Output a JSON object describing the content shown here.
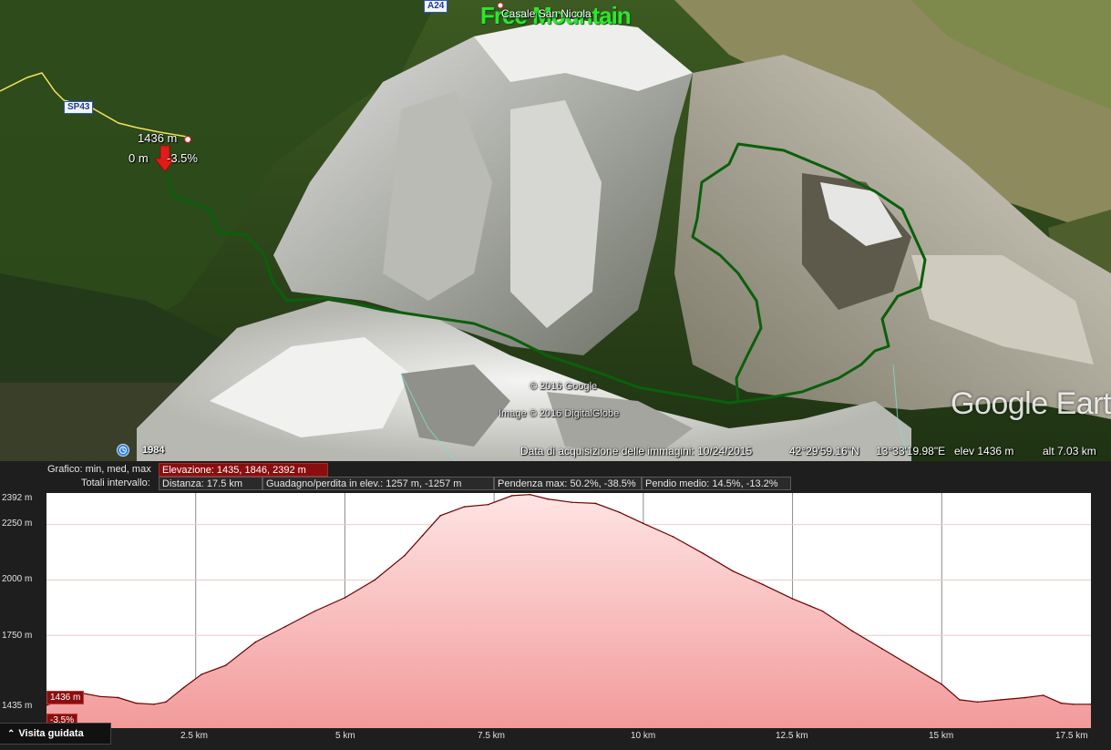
{
  "map": {
    "watermark": "Free Mountain",
    "place_label": "Casale San Nicola",
    "highway_shield": "A24",
    "road_shield": "SP43",
    "track_start_elev": "1436 m",
    "track_start_dist": "0 m",
    "track_start_slope": "-3.5%",
    "copyright": "© 2016 Google",
    "imagery_credit": "Image © 2016 DigitalGlobe",
    "logo": "Google Earth",
    "historical_year": "1984",
    "status": {
      "acquisition": "Data di acquisizione delle immagini: 10/24/2015",
      "lat": "42°29'59.16\"N",
      "lon": "13°33'19.98\"E",
      "elev": "elev  1436 m",
      "alt": "alt  7.03 km"
    },
    "colors": {
      "track": "#0b5f0b",
      "watermark": "#2ee62e"
    }
  },
  "profile": {
    "grafico_label": "Grafico: min, med, max",
    "elevazione": "Elevazione: 1435, 1846, 2392 m",
    "totali_label": "Totali intervallo:",
    "distanza": "Distanza: 17.5 km",
    "guadagno": "Guadagno/perdita in elev.: 1257 m, -1257 m",
    "pendenza": "Pendenza max: 50.2%, -38.5%",
    "pendio": "Pendio medio: 14.5%, -13.2%",
    "y_labels": [
      "2392 m",
      "2250 m",
      "2000 m",
      "1750 m",
      "1435 m"
    ],
    "x_labels": [
      "2.5 km",
      "5 km",
      "7.5 km",
      "10 km",
      "12.5 km",
      "15 km",
      "17.5 km"
    ],
    "cursor_elev": "1436 m",
    "cursor_slope": "-3.5%",
    "tour_button": "Visita guidata"
  },
  "chart_data": {
    "type": "area",
    "title": "",
    "xlabel": "",
    "ylabel": "",
    "x_unit": "km",
    "y_unit": "m",
    "xlim": [
      0,
      17.5
    ],
    "ylim": [
      1435,
      2392
    ],
    "x": [
      0,
      0.3,
      0.6,
      0.9,
      1.2,
      1.5,
      1.8,
      2.0,
      2.3,
      2.6,
      3.0,
      3.5,
      4.0,
      4.5,
      5.0,
      5.5,
      6.0,
      6.3,
      6.6,
      7.0,
      7.4,
      7.8,
      8.1,
      8.4,
      8.8,
      9.2,
      9.6,
      10.0,
      10.5,
      11.0,
      11.5,
      12.0,
      12.5,
      13.0,
      13.5,
      14.0,
      14.5,
      15.0,
      15.3,
      15.6,
      16.0,
      16.4,
      16.7,
      17.0,
      17.2,
      17.5
    ],
    "series": [
      {
        "values": [
          1436,
          1460,
          1490,
          1475,
          1470,
          1445,
          1440,
          1450,
          1515,
          1575,
          1615,
          1720,
          1790,
          1860,
          1920,
          2000,
          2110,
          2200,
          2290,
          2330,
          2340,
          2380,
          2385,
          2365,
          2350,
          2345,
          2305,
          2255,
          2195,
          2120,
          2040,
          1980,
          1915,
          1860,
          1770,
          1690,
          1610,
          1530,
          1460,
          1450,
          1460,
          1470,
          1480,
          1445,
          1440,
          1440
        ]
      }
    ]
  }
}
